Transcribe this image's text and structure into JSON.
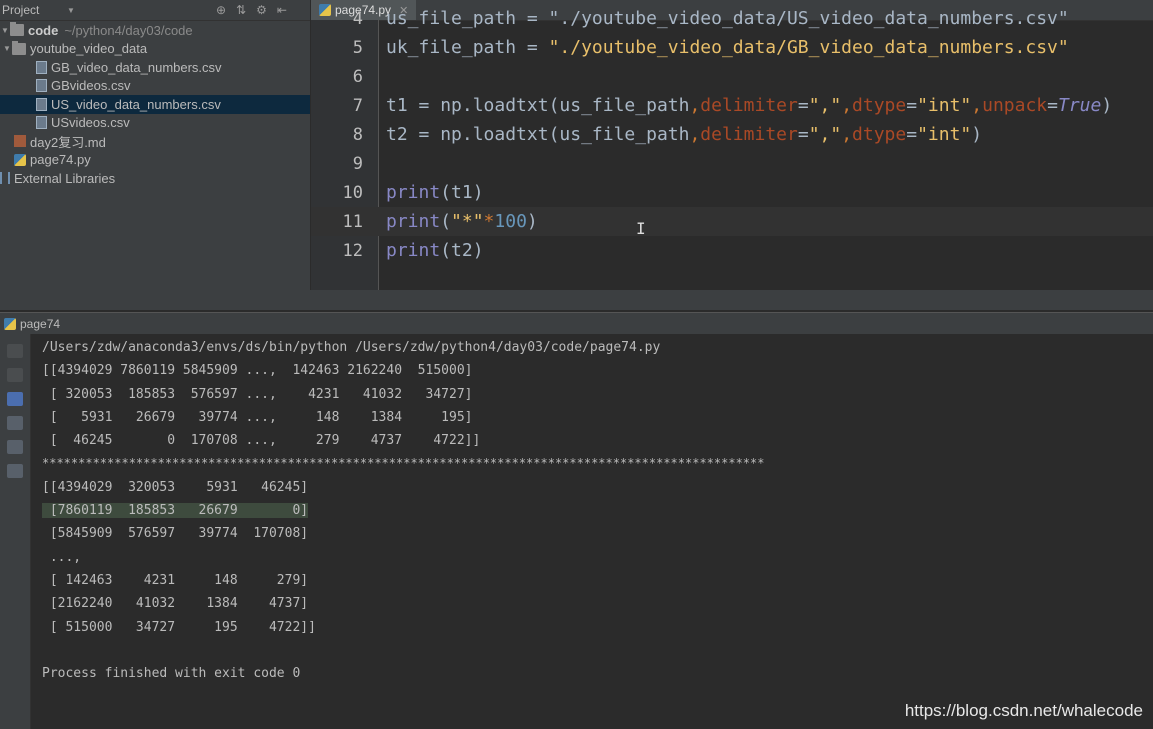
{
  "project": {
    "title": "Project",
    "root_name": "code",
    "root_path": "~/python4/day03/code",
    "folder": "youtube_video_data",
    "files": [
      "GB_video_data_numbers.csv",
      "GBvideos.csv",
      "US_video_data_numbers.csv",
      "USvideos.csv"
    ],
    "other_files": [
      "day2复习.md",
      "page74.py"
    ],
    "external": "External Libraries"
  },
  "editor": {
    "tab": "page74.py",
    "lines": [
      {
        "n": "5",
        "kind": "uk"
      },
      {
        "n": "6",
        "kind": "blank"
      },
      {
        "n": "7",
        "kind": "t1"
      },
      {
        "n": "8",
        "kind": "t2"
      },
      {
        "n": "9",
        "kind": "blank"
      },
      {
        "n": "10",
        "kind": "p1"
      },
      {
        "n": "11",
        "kind": "p2"
      },
      {
        "n": "12",
        "kind": "p3"
      }
    ],
    "top_partial": "us_file_path = \"./youtube_video_data/US_video_data_numbers.csv\"",
    "uk_var": "uk_file_path",
    "uk_str": "\"./youtube_video_data/GB_video_data_numbers.csv\"",
    "t1": "t1",
    "t2": "t2",
    "np_call": "np.loadtxt(us_file_path",
    "delimiter": "delimiter",
    "comma_str": "\",\"",
    "dtype": "dtype",
    "int_str": "\"int\"",
    "unpack": "unpack",
    "true_kw": "True",
    "print": "print",
    "t1_arg": "(t1)",
    "t2_arg": "(t2)",
    "star_str": "\"*\"",
    "hundred": "100"
  },
  "run": {
    "tab": "page74",
    "output": [
      "/Users/zdw/anaconda3/envs/ds/bin/python /Users/zdw/python4/day03/code/page74.py",
      "[[4394029 7860119 5845909 ...,  142463 2162240  515000]",
      " [ 320053  185853  576597 ...,    4231   41032   34727]",
      " [   5931   26679   39774 ...,     148    1384     195]",
      " [  46245       0  170708 ...,     279    4737    4722]]",
      "****************************************************************************************************",
      "[[4394029  320053    5931   46245]",
      " [7860119  185853   26679       0]",
      " [5845909  576597   39774  170708]",
      " ...,",
      " [ 142463    4231     148     279]",
      " [2162240   41032    1384    4737]",
      " [ 515000   34727     195    4722]]",
      "",
      "Process finished with exit code 0"
    ]
  },
  "watermark": "https://blog.csdn.net/whalecode"
}
